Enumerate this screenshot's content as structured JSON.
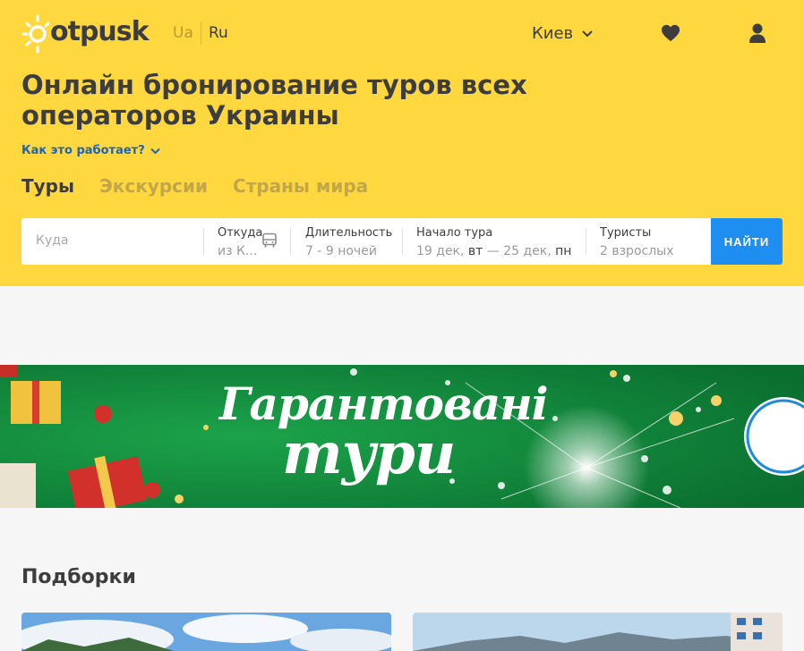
{
  "header": {
    "logo_text": "otpusk",
    "lang_ua": "Ua",
    "lang_ru": "Ru",
    "city": "Киев",
    "icons": [
      "heart-icon",
      "user-icon",
      "chevron-down-icon"
    ]
  },
  "hero": {
    "title": "Онлайн бронирование туров всех операторов Украины",
    "how_link": "Как это работает?",
    "tabs": [
      {
        "label": "Туры",
        "active": true
      },
      {
        "label": "Экскурсии",
        "active": false
      },
      {
        "label": "Страны мира",
        "active": false
      }
    ]
  },
  "search": {
    "where_placeholder": "Куда",
    "from_label": "Откуда",
    "from_value": "из К...",
    "duration_label": "Длительность",
    "duration_value": "7 - 9 ночей",
    "start_label": "Начало тура",
    "start_date1": "19 дек,",
    "start_day1": "вт",
    "start_sep": "—",
    "start_date2": "25 дек,",
    "start_day2": "пн",
    "tourists_label": "Туристы",
    "tourists_value": "2 взрослых",
    "find_button": "НАЙТИ"
  },
  "banner": {
    "line1": "Гарантовані",
    "line2": "тури"
  },
  "collections": {
    "title": "Подборки"
  },
  "colors": {
    "hero_bg": "#ffd73f",
    "accent_blue": "#1f8ef1",
    "link_blue": "#1c65b9",
    "banner_green": "#0f8a3c"
  }
}
